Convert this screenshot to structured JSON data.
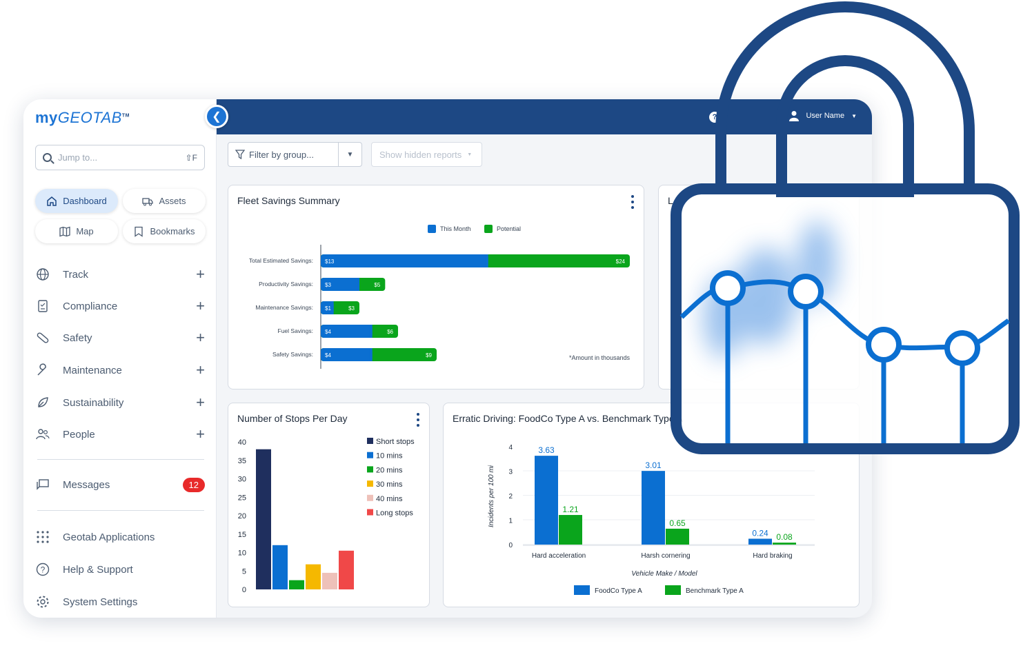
{
  "app": {
    "logo_my": "my",
    "logo_geo": "GEOTAB",
    "logo_tm": "TM",
    "collapse_icon": "chevron-left-icon",
    "search": {
      "placeholder": "Jump to...",
      "shortcut": "⇧F"
    },
    "quick": [
      {
        "label": "Dashboard",
        "icon": "home-icon",
        "active": true
      },
      {
        "label": "Assets",
        "icon": "truck-icon",
        "active": false
      },
      {
        "label": "Map",
        "icon": "map-icon",
        "active": false
      },
      {
        "label": "Bookmarks",
        "icon": "bookmark-icon",
        "active": false
      }
    ],
    "nav": [
      {
        "label": "Track",
        "icon": "globe-icon"
      },
      {
        "label": "Compliance",
        "icon": "clipboard-icon"
      },
      {
        "label": "Safety",
        "icon": "bandage-icon"
      },
      {
        "label": "Maintenance",
        "icon": "wrench-icon"
      },
      {
        "label": "Sustainability",
        "icon": "leaf-icon"
      },
      {
        "label": "People",
        "icon": "people-icon"
      }
    ],
    "messages": {
      "label": "Messages",
      "count": "12"
    },
    "bottom_nav": [
      {
        "label": "Geotab Applications",
        "icon": "grid-icon"
      },
      {
        "label": "Help & Support",
        "icon": "help-circle-icon"
      },
      {
        "label": "System Settings",
        "icon": "gear-icon"
      }
    ],
    "topbar": {
      "help": "?",
      "user": "User Name"
    },
    "toolbar": {
      "filter": "Filter by group...",
      "hidden": "Show hidden reports"
    }
  },
  "cards": {
    "fleet": {
      "title": "Fleet Savings Summary",
      "note": "*Amount in thousands"
    },
    "stops": {
      "title": "Number of Stops Per Day"
    },
    "erratic": {
      "title": "Erratic Driving: FoodCo Type A vs. Benchmark Type A",
      "partial_right": "L"
    }
  },
  "chart_data": [
    {
      "type": "bar",
      "orientation": "horizontal",
      "stacked": true,
      "title": "Fleet Savings Summary",
      "categories": [
        "Total Estimated Savings:",
        "Productivity Savings:",
        "Maintenance Savings:",
        "Fuel Savings:",
        "Safety Savings:"
      ],
      "series": [
        {
          "name": "This Month",
          "color": "#0b6fd1",
          "values": [
            13,
            3,
            1,
            4,
            4
          ],
          "labels": [
            "$13",
            "$3",
            "$1",
            "$4",
            "$4"
          ]
        },
        {
          "name": "Potential",
          "color": "#0aa51c",
          "values": [
            24,
            5,
            3,
            6,
            9
          ],
          "labels": [
            "$24",
            "$5",
            "$3",
            "$6",
            "$9"
          ]
        }
      ],
      "legend": "top"
    },
    {
      "type": "bar",
      "title": "Number of Stops Per Day",
      "ylim": [
        0,
        40
      ],
      "yticks": [
        "40",
        "35",
        "30",
        "25",
        "20",
        "15",
        "10",
        "5",
        "0"
      ],
      "series": [
        {
          "name": "Short stops",
          "color": "#1f2f5e",
          "value": 38
        },
        {
          "name": "10 mins",
          "color": "#0b6fd1",
          "value": 12
        },
        {
          "name": "20 mins",
          "color": "#0aa51c",
          "value": 2.5
        },
        {
          "name": "30 mins",
          "color": "#f5b800",
          "value": 6.8
        },
        {
          "name": "40 mins",
          "color": "#eec1b9",
          "value": 4.5
        },
        {
          "name": "Long stops",
          "color": "#f04848",
          "value": 10.5
        }
      ],
      "legend": "right"
    },
    {
      "type": "bar",
      "title": "Erratic Driving: FoodCo Type A vs. Benchmark Type A",
      "xlabel": "Vehicle Make / Model",
      "ylabel": "Incidents per 100 mi",
      "ylim": [
        0,
        4
      ],
      "yticks": [
        "4",
        "3",
        "2",
        "1",
        "0"
      ],
      "categories": [
        "Hard acceleration",
        "Harsh cornering",
        "Hard braking"
      ],
      "series": [
        {
          "name": "FoodCo Type A",
          "color": "#0b6fd1",
          "values": [
            3.63,
            3.01,
            0.24
          ],
          "labels": [
            "3.63",
            "3.01",
            "0.24"
          ]
        },
        {
          "name": "Benchmark Type A",
          "color": "#0aa51c",
          "values": [
            1.21,
            0.65,
            0.08
          ],
          "labels": [
            "1.21",
            "0.65",
            "0.08"
          ]
        }
      ],
      "legend": "bottom"
    }
  ],
  "overlay": {
    "icon": "padlock-icon",
    "color": "#1d4884",
    "line_color": "#0b6fd1"
  }
}
